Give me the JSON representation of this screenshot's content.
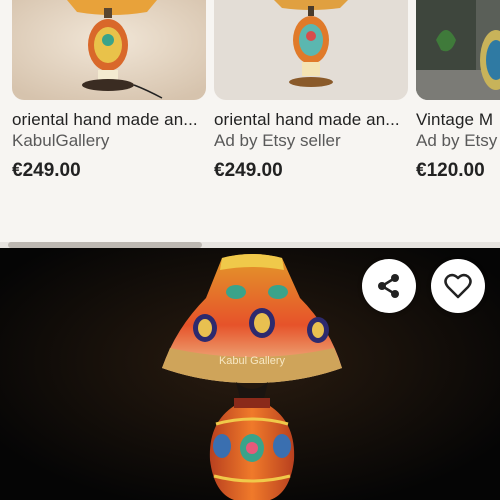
{
  "listings": [
    {
      "title": "oriental hand made an...",
      "seller": "KabulGallery",
      "price": "€249.00"
    },
    {
      "title": "oriental hand made an...",
      "seller": "Ad by Etsy seller",
      "price": "€249.00"
    },
    {
      "title": "Vintage M",
      "seller": "Ad by Etsy",
      "price": "€120.00"
    }
  ],
  "hero": {
    "watermark": "Kabul Gallery"
  },
  "icons": {
    "share": "share-icon",
    "favorite": "heart-icon"
  },
  "colors": {
    "background": "#f7f5f2",
    "text": "#222222",
    "muted": "#595959",
    "hero_bg": "#0a0a0a"
  }
}
